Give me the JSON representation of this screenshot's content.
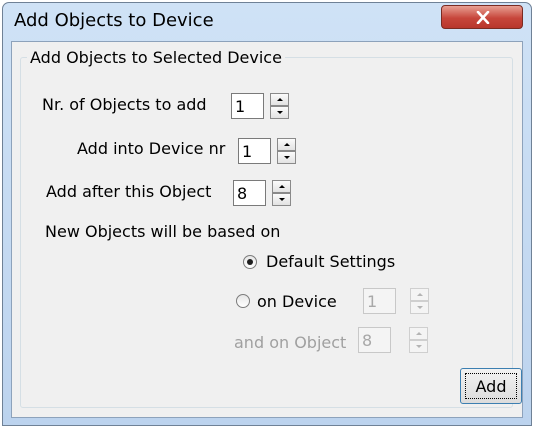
{
  "window": {
    "title": "Add Objects to Device"
  },
  "group": {
    "legend": "Add Objects to Selected Device"
  },
  "fields": {
    "objects_to_add": {
      "label": "Nr. of Objects to add",
      "value": "1"
    },
    "device_nr": {
      "label": "Add into Device nr",
      "value": "1"
    },
    "after_object": {
      "label": "Add after this Object",
      "value": "8"
    }
  },
  "based_on": {
    "label": "New Objects will be based on",
    "default_settings": {
      "label": "Default Settings",
      "checked": true
    },
    "on_device": {
      "label": "on Device",
      "value": "1",
      "checked": false
    },
    "on_object": {
      "label": "and on Object",
      "value": "8"
    }
  },
  "buttons": {
    "add_label": "Add"
  },
  "icons": {
    "close": "close-icon",
    "spin": "spin-up-down-icon"
  },
  "colors": {
    "title_bar": "#c6dbf2",
    "close_button": "#c7463b",
    "dialog_background": "#f0f0f0",
    "disabled_text": "#a0a0a0"
  }
}
